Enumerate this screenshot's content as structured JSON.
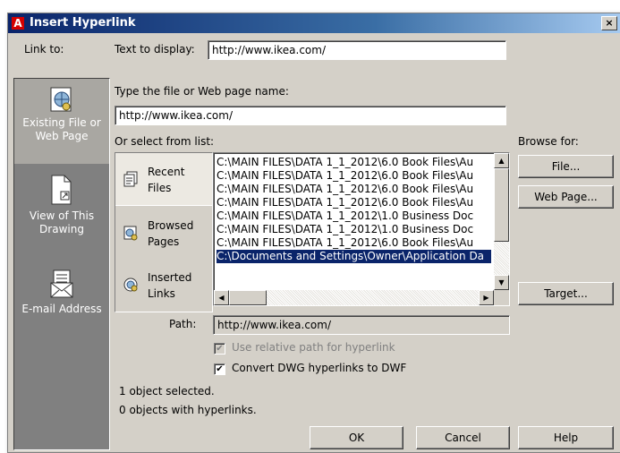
{
  "window": {
    "title": "Insert Hyperlink",
    "close_glyph": "×",
    "app_icon_letter": "A"
  },
  "link_to": {
    "label": "Link to:",
    "items": [
      {
        "label": "Existing File or Web Page",
        "selected": true,
        "icon": "web-page-icon"
      },
      {
        "label": "View of This Drawing",
        "selected": false,
        "icon": "drawing-view-icon"
      },
      {
        "label": "E-mail Address",
        "selected": false,
        "icon": "email-icon"
      }
    ]
  },
  "text_to_display": {
    "label": "Text to display:",
    "value": "http://www.ikea.com/"
  },
  "file_name": {
    "label": "Type the file or Web page name:",
    "value": "http://www.ikea.com/"
  },
  "select_list": {
    "label": "Or select from list:",
    "tabs": [
      {
        "label": "Recent Files",
        "icon": "recent-files-icon",
        "active": true
      },
      {
        "label": "Browsed Pages",
        "icon": "browsed-pages-icon",
        "active": false
      },
      {
        "label": "Inserted Links",
        "icon": "inserted-links-icon",
        "active": false
      }
    ],
    "items": [
      "C:\\MAIN FILES\\DATA 1_1_2012\\6.0 Book Files\\Au",
      "C:\\MAIN FILES\\DATA 1_1_2012\\6.0 Book Files\\Au",
      "C:\\MAIN FILES\\DATA 1_1_2012\\6.0 Book Files\\Au",
      "C:\\MAIN FILES\\DATA 1_1_2012\\6.0 Book Files\\Au",
      "C:\\MAIN FILES\\DATA 1_1_2012\\1.0 Business Doc",
      "C:\\MAIN FILES\\DATA 1_1_2012\\1.0 Business Doc",
      "C:\\MAIN FILES\\DATA 1_1_2012\\6.0 Book Files\\Au",
      "C:\\Documents and Settings\\Owner\\Application Da"
    ],
    "selected_index": 7
  },
  "browse": {
    "label": "Browse for:",
    "file_button": "File...",
    "web_page_button": "Web Page..."
  },
  "target_button": "Target...",
  "path": {
    "label": "Path:",
    "value": "http://www.ikea.com/"
  },
  "options": {
    "relative_path": {
      "label": "Use relative path for hyperlink",
      "checked": true,
      "enabled": false
    },
    "convert_dwg": {
      "label": "Convert DWG hyperlinks to DWF",
      "checked": true,
      "enabled": true
    }
  },
  "status": {
    "selected": "1 object selected.",
    "with_links": "0 objects with hyperlinks."
  },
  "buttons": {
    "ok": "OK",
    "cancel": "Cancel",
    "help": "Help"
  },
  "check_glyph": "✔"
}
